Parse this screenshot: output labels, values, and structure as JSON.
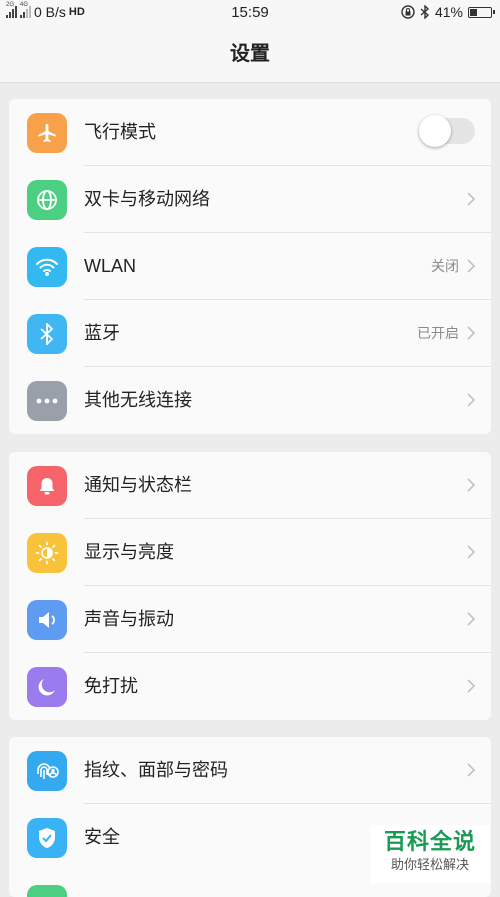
{
  "status_bar": {
    "net_left": "2G",
    "net_right": "4G",
    "speed": "0 B/s",
    "hd": "HD",
    "time": "15:59",
    "battery": "41%",
    "battery_level": 0.41
  },
  "header": {
    "title": "设置"
  },
  "groups": [
    {
      "items": [
        {
          "label": "飞行模式",
          "icon": "airplane-icon",
          "color": "#f7a24a",
          "toggle": false
        },
        {
          "label": "双卡与移动网络",
          "icon": "globe-icon",
          "color": "#4ccf83"
        },
        {
          "label": "WLAN",
          "icon": "wifi-icon",
          "color": "#33b8f2",
          "status": "关闭"
        },
        {
          "label": "蓝牙",
          "icon": "bluetooth-icon",
          "color": "#40b6f3",
          "status": "已开启"
        },
        {
          "label": "其他无线连接",
          "icon": "more-icon",
          "color": "#9aa0aa"
        }
      ]
    },
    {
      "items": [
        {
          "label": "通知与状态栏",
          "icon": "bell-icon",
          "color": "#f5646a"
        },
        {
          "label": "显示与亮度",
          "icon": "brightness-icon",
          "color": "#f8c23a"
        },
        {
          "label": "声音与振动",
          "icon": "speaker-icon",
          "color": "#5d9cf1"
        },
        {
          "label": "免打扰",
          "icon": "moon-icon",
          "color": "#9a7cef"
        }
      ]
    },
    {
      "items": [
        {
          "label": "指纹、面部与密码",
          "icon": "fingerprint-icon",
          "color": "#35a9f0"
        },
        {
          "label": "安全",
          "icon": "shield-icon",
          "color": "#39b3f5"
        }
      ]
    }
  ],
  "watermark": {
    "title": "百科全说",
    "subtitle": "助你轻松解决"
  }
}
